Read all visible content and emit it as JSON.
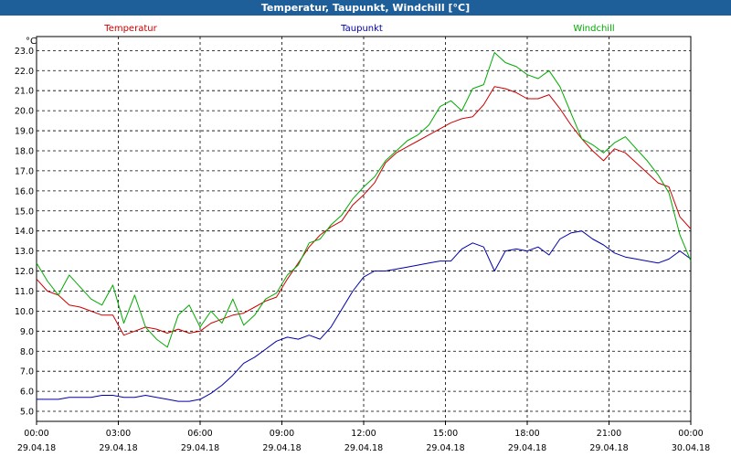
{
  "window": {
    "title": "Temperatur, Taupunkt, Windchill [°C]"
  },
  "chart_data": {
    "type": "line",
    "title": "Temperatur, Taupunkt, Windchill [°C]",
    "ylabel": "°C",
    "ylim": [
      4.5,
      23.7
    ],
    "y_ticks": [
      5.0,
      6.0,
      7.0,
      8.0,
      9.0,
      10.0,
      11.0,
      12.0,
      13.0,
      14.0,
      15.0,
      16.0,
      17.0,
      18.0,
      19.0,
      20.0,
      21.0,
      22.0,
      23.0
    ],
    "x_ticks": [
      {
        "time": "00:00",
        "date": "29.04.18"
      },
      {
        "time": "03:00",
        "date": "29.04.18"
      },
      {
        "time": "06:00",
        "date": "29.04.18"
      },
      {
        "time": "09:00",
        "date": "29.04.18"
      },
      {
        "time": "12:00",
        "date": "29.04.18"
      },
      {
        "time": "15:00",
        "date": "29.04.18"
      },
      {
        "time": "18:00",
        "date": "29.04.18"
      },
      {
        "time": "21:00",
        "date": "29.04.18"
      },
      {
        "time": "00:00",
        "date": "30.04.18"
      }
    ],
    "grid": true,
    "legend": "top",
    "series": [
      {
        "name": "Temperatur",
        "color": "#cc0000",
        "x": [
          0.0,
          0.4,
          0.8,
          1.2,
          1.6,
          2.0,
          2.4,
          2.8,
          3.2,
          3.6,
          4.0,
          4.4,
          4.8,
          5.2,
          5.6,
          6.0,
          6.4,
          6.8,
          7.2,
          7.6,
          8.0,
          8.4,
          8.8,
          9.2,
          9.6,
          10.0,
          10.4,
          10.8,
          11.2,
          11.6,
          12.0,
          12.4,
          12.8,
          13.2,
          13.6,
          14.0,
          14.4,
          14.8,
          15.2,
          15.6,
          16.0,
          16.4,
          16.8,
          17.2,
          17.6,
          18.0,
          18.4,
          18.8,
          19.2,
          19.6,
          20.0,
          20.4,
          20.8,
          21.2,
          21.6,
          22.0,
          22.4,
          22.8,
          23.2,
          23.6,
          24.0
        ],
        "values": [
          11.6,
          11.0,
          10.8,
          10.3,
          10.2,
          10.0,
          9.8,
          9.8,
          8.8,
          9.0,
          9.2,
          9.1,
          8.9,
          9.1,
          8.9,
          9.0,
          9.4,
          9.6,
          9.8,
          9.9,
          10.2,
          10.5,
          10.7,
          11.6,
          12.4,
          13.2,
          13.8,
          14.2,
          14.5,
          15.3,
          15.8,
          16.4,
          17.4,
          17.9,
          18.2,
          18.5,
          18.8,
          19.1,
          19.4,
          19.6,
          19.7,
          20.3,
          21.2,
          21.1,
          20.9,
          20.6,
          20.6,
          20.8,
          20.1,
          19.3,
          18.6,
          18.0,
          17.5,
          18.1,
          17.9,
          17.4,
          16.9,
          16.4,
          16.2,
          14.7,
          14.1
        ]
      },
      {
        "name": "Taupunkt",
        "color": "#0000aa",
        "x": [
          0.0,
          0.4,
          0.8,
          1.2,
          1.6,
          2.0,
          2.4,
          2.8,
          3.2,
          3.6,
          4.0,
          4.4,
          4.8,
          5.2,
          5.6,
          6.0,
          6.4,
          6.8,
          7.2,
          7.6,
          8.0,
          8.4,
          8.8,
          9.2,
          9.6,
          10.0,
          10.4,
          10.8,
          11.2,
          11.6,
          12.0,
          12.4,
          12.8,
          13.2,
          13.6,
          14.0,
          14.4,
          14.8,
          15.2,
          15.6,
          16.0,
          16.4,
          16.8,
          17.2,
          17.6,
          18.0,
          18.4,
          18.8,
          19.2,
          19.6,
          20.0,
          20.4,
          20.8,
          21.2,
          21.6,
          22.0,
          22.4,
          22.8,
          23.2,
          23.6,
          24.0
        ],
        "values": [
          5.6,
          5.6,
          5.6,
          5.7,
          5.7,
          5.7,
          5.8,
          5.8,
          5.7,
          5.7,
          5.8,
          5.7,
          5.6,
          5.5,
          5.5,
          5.6,
          5.9,
          6.3,
          6.8,
          7.4,
          7.7,
          8.1,
          8.5,
          8.7,
          8.6,
          8.8,
          8.6,
          9.2,
          10.1,
          11.0,
          11.7,
          12.0,
          12.0,
          12.1,
          12.2,
          12.3,
          12.4,
          12.5,
          12.5,
          13.1,
          13.4,
          13.2,
          12.0,
          13.0,
          13.1,
          13.0,
          13.2,
          12.8,
          13.6,
          13.9,
          14.0,
          13.6,
          13.3,
          12.9,
          12.7,
          12.6,
          12.5,
          12.4,
          12.6,
          13.0,
          12.6
        ]
      },
      {
        "name": "Windchill",
        "color": "#00aa00",
        "x": [
          0.0,
          0.4,
          0.8,
          1.2,
          1.6,
          2.0,
          2.4,
          2.8,
          3.2,
          3.6,
          4.0,
          4.4,
          4.8,
          5.2,
          5.6,
          6.0,
          6.4,
          6.8,
          7.2,
          7.6,
          8.0,
          8.4,
          8.8,
          9.2,
          9.6,
          10.0,
          10.4,
          10.8,
          11.2,
          11.6,
          12.0,
          12.4,
          12.8,
          13.2,
          13.6,
          14.0,
          14.4,
          14.8,
          15.2,
          15.6,
          16.0,
          16.4,
          16.8,
          17.2,
          17.6,
          18.0,
          18.4,
          18.8,
          19.2,
          19.6,
          20.0,
          20.4,
          20.8,
          21.2,
          21.6,
          22.0,
          22.4,
          22.8,
          23.2,
          23.6,
          24.0
        ],
        "values": [
          12.4,
          11.5,
          10.8,
          11.8,
          11.2,
          10.6,
          10.3,
          11.3,
          9.4,
          10.8,
          9.2,
          8.6,
          8.2,
          9.8,
          10.3,
          9.2,
          10.0,
          9.4,
          10.6,
          9.3,
          9.8,
          10.6,
          10.9,
          11.8,
          12.3,
          13.4,
          13.6,
          14.3,
          14.8,
          15.6,
          16.2,
          16.7,
          17.5,
          18.0,
          18.5,
          18.8,
          19.3,
          20.2,
          20.5,
          20.0,
          21.1,
          21.3,
          22.9,
          22.4,
          22.2,
          21.8,
          21.6,
          22.0,
          21.2,
          19.9,
          18.6,
          18.3,
          17.9,
          18.4,
          18.7,
          18.1,
          17.5,
          16.8,
          15.9,
          13.8,
          12.5
        ]
      }
    ]
  }
}
